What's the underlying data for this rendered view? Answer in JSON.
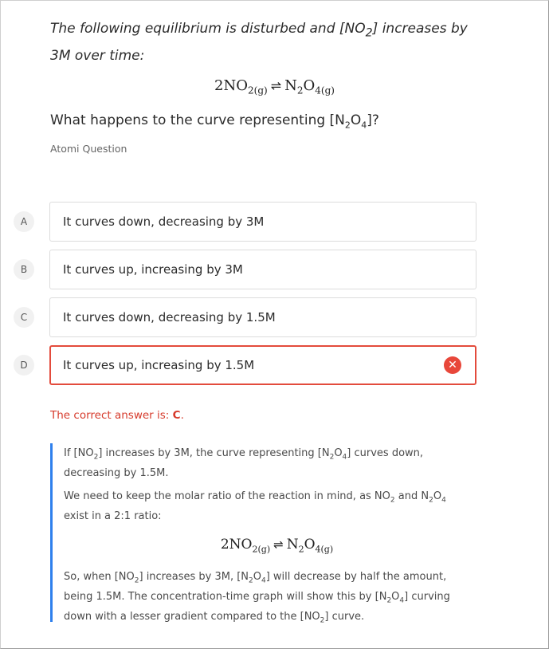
{
  "question": {
    "intro_part1": "The following equilibrium is disturbed and [NO",
    "intro_sub": "2",
    "intro_part2": "] increases by 3M over time:",
    "equation": {
      "left": "2NO",
      "left_sub": "2(g)",
      "arrow": "⇌",
      "right": "N",
      "right_sub1": "2",
      "right_mid": "O",
      "right_sub2": "4(g)"
    },
    "prompt_part1": "What happens to the curve representing [N",
    "prompt_sub1": "2",
    "prompt_mid": "O",
    "prompt_sub2": "4",
    "prompt_part2": "]?",
    "source": "Atomi Question"
  },
  "options": [
    {
      "letter": "A",
      "text": "It curves down, decreasing by 3M"
    },
    {
      "letter": "B",
      "text": "It curves up, increasing by 3M"
    },
    {
      "letter": "C",
      "text": "It curves down, decreasing by 1.5M"
    },
    {
      "letter": "D",
      "text": "It curves up, increasing by 1.5M",
      "selected_wrong": true
    }
  ],
  "wrong_icon": "close-icon",
  "result": {
    "prefix": "The correct answer is: ",
    "answer": "C",
    "suffix": "."
  },
  "explanation": {
    "p1": {
      "a": "If [NO",
      "a_sub": "2",
      "b": "] increases by 3M, the curve representing [N",
      "b_sub": "2",
      "c": "O",
      "c_sub": "4",
      "d": "] curves down, decreasing by 1.5M."
    },
    "p2": {
      "a": "We need to keep the molar ratio of the reaction in mind, as NO",
      "a_sub": "2",
      "b": " and N",
      "b_sub": "2",
      "c": "O",
      "c_sub": "4",
      "d": " exist in a 2:1 ratio:"
    },
    "p3": {
      "a": "So, when [NO",
      "a_sub": "2",
      "b": "] increases by 3M, [N",
      "b_sub": "2",
      "c": "O",
      "c_sub": "4",
      "d": "] will decrease by half the amount, being 1.5M. The concentration-time graph will show this by [N",
      "d_sub": "2",
      "e": "O",
      "e_sub": "4",
      "f": "] curving down with a lesser gradient compared to the [NO",
      "f_sub": "2",
      "g": "] curve."
    }
  },
  "colors": {
    "wrong": "#e34b3c",
    "correct_text": "#d63a2b",
    "explain_bar": "#2f80ed"
  }
}
